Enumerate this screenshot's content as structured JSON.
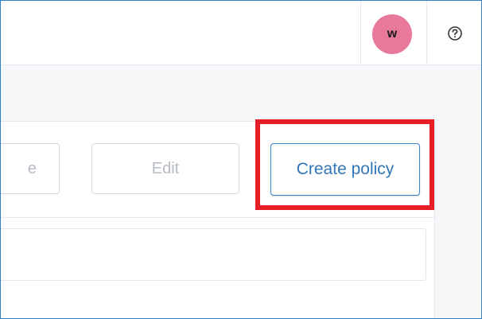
{
  "header": {
    "avatar_initial": "w",
    "avatar_color": "#e8799a",
    "help_icon": "question-circle-icon"
  },
  "toolbar": {
    "partial_button_label": "e",
    "edit_label": "Edit",
    "create_policy_label": "Create policy"
  },
  "annotation": {
    "highlight_color": "#e61e28",
    "target": "create-policy-button"
  }
}
